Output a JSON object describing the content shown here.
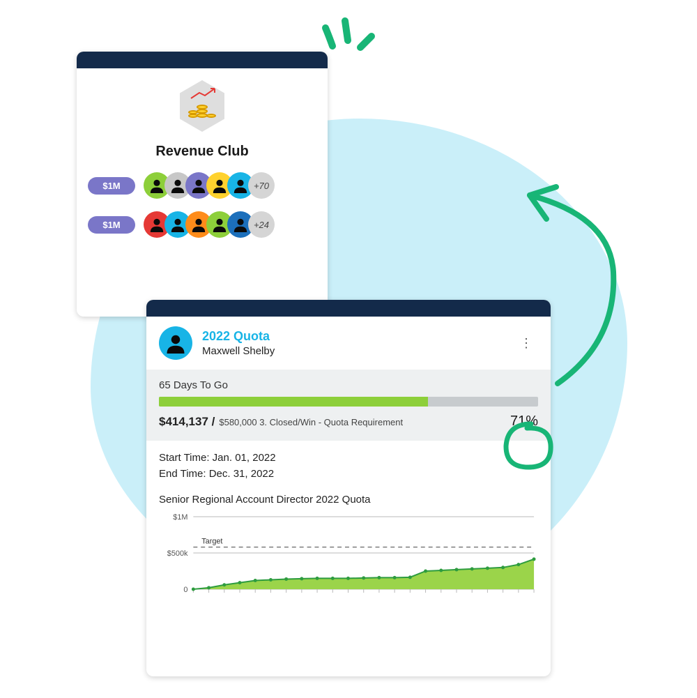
{
  "revenue_club": {
    "title": "Revenue Club",
    "tiers": [
      {
        "label": "$1M",
        "avatar_colors": [
          "#8dcf3a",
          "#c7c7c7",
          "#7a76c8",
          "#ffd22e",
          "#18b4e6"
        ],
        "more": "+70"
      },
      {
        "label": "$1M",
        "avatar_colors": [
          "#e53935",
          "#18b4e6",
          "#ff8c1a",
          "#8dcf3a",
          "#1c6fbb"
        ],
        "more": "+24"
      }
    ]
  },
  "quota": {
    "title": "2022 Quota",
    "person": "Maxwell Shelby",
    "days_to_go": "65 Days To Go",
    "progress_pct": 71,
    "progress_pct_label": "71%",
    "amount": "$414,137 /",
    "amount_detail": "$580,000 3. Closed/Win - Quota Requirement",
    "start_time": "Start Time: Jan. 01, 2022",
    "end_time": "End Time: Dec. 31, 2022",
    "chart_title": "Senior Regional Account Director 2022 Quota"
  },
  "chart_data": {
    "type": "area",
    "title": "Senior Regional Account Director 2022 Quota",
    "ylabel": "",
    "yticks": [
      "$1M",
      "$500k",
      "0"
    ],
    "ylim": [
      0,
      1000000
    ],
    "target_label": "Target",
    "target_value": 580000,
    "x": [
      0,
      1,
      2,
      3,
      4,
      5,
      6,
      7,
      8,
      9,
      10,
      11,
      12,
      13,
      14,
      15,
      16,
      17,
      18,
      19,
      20,
      21,
      22
    ],
    "values": [
      0,
      20000,
      60000,
      90000,
      120000,
      130000,
      140000,
      145000,
      150000,
      150000,
      150000,
      155000,
      160000,
      160000,
      165000,
      250000,
      260000,
      270000,
      280000,
      290000,
      300000,
      340000,
      414137
    ]
  }
}
